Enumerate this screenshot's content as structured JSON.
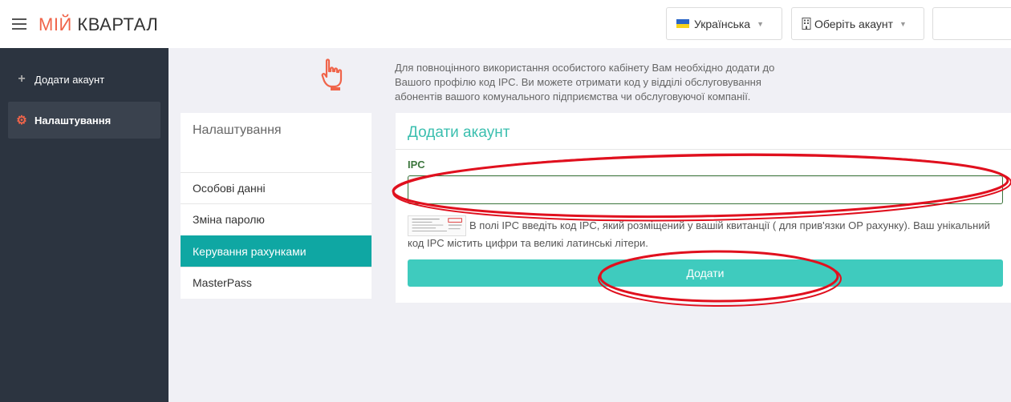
{
  "header": {
    "brand_part1": "МІЙ",
    "brand_part2": "КВАРТАЛ",
    "language_label": "Українська",
    "account_label": "Оберіть акаунт"
  },
  "sidebar": {
    "items": [
      {
        "label": "Додати акаунт",
        "icon": "plus-icon"
      },
      {
        "label": "Налаштування",
        "icon": "gear-icon"
      }
    ]
  },
  "notice": {
    "line1": "Для повноцінного використання особистого кабінету Вам необхідно додати до",
    "line2": "Вашого профілю код IPC. Ви можете отримати код у відділі обслуговування",
    "line3": "абонентів вашого комунального підприємства чи обслуговуючої компанії."
  },
  "settings_panel": {
    "title": "Налаштування",
    "items": [
      {
        "label": "Особові данні"
      },
      {
        "label": "Зміна паролю"
      },
      {
        "label": "Керування рахунками"
      },
      {
        "label": "MasterPass"
      }
    ]
  },
  "add_account": {
    "title": "Додати акаунт",
    "ipc_label": "IPC",
    "ipc_value": "",
    "hint": "В полі IPC введіть код IPC, який розміщений у вашій квитанції ( для прив'язки ОР рахунку). Ваш унікальний код IPC містить цифри та великі латинські літери.",
    "submit_label": "Додати"
  },
  "colors": {
    "brand_accent": "#f0644a",
    "sidebar_bg": "#2c3440",
    "active_tab": "#0fa7a3",
    "primary_button": "#3fcbbe",
    "annotation": "#e0101e"
  }
}
